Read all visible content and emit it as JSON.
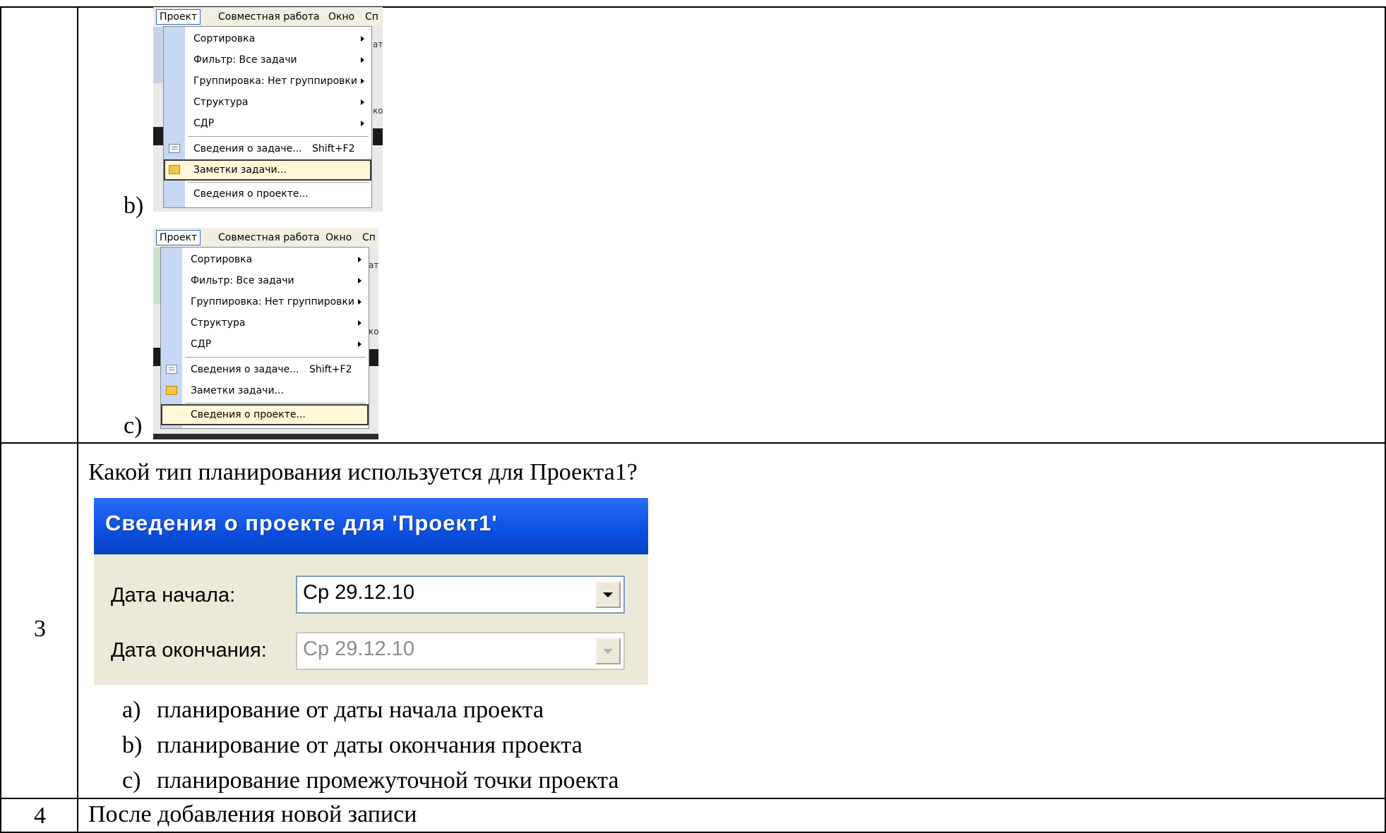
{
  "rows": {
    "row3_number": "3",
    "row4_number": "4"
  },
  "menu_options": [
    {
      "marker": "b)",
      "menubar": [
        "Проект",
        "Совместная работа",
        "Окно",
        "Сп"
      ],
      "background_right_fragments": [
        "ат",
        "ко"
      ],
      "items": [
        {
          "label": "Сортировка",
          "submenu": true
        },
        {
          "label": "Фильтр: Все задачи",
          "submenu": true
        },
        {
          "label": "Группировка: Нет группировки",
          "submenu": true
        },
        {
          "label": "Структура",
          "submenu": true
        },
        {
          "label": "СДР",
          "submenu": true
        },
        {
          "label": "Сведения о задаче...",
          "shortcut": "Shift+F2",
          "icon": "task-info-icon"
        },
        {
          "label": "Заметки задачи...",
          "icon": "task-notes-icon",
          "highlighted": true
        },
        {
          "label": "Сведения о проекте..."
        }
      ]
    },
    {
      "marker": "c)",
      "menubar": [
        "Проект",
        "Совместная работа",
        "Окно",
        "Сп"
      ],
      "background_right_fragments": [
        "ат",
        "ко"
      ],
      "items": [
        {
          "label": "Сортировка",
          "submenu": true
        },
        {
          "label": "Фильтр: Все задачи",
          "submenu": true
        },
        {
          "label": "Группировка: Нет группировки",
          "submenu": true
        },
        {
          "label": "Структура",
          "submenu": true
        },
        {
          "label": "СДР",
          "submenu": true
        },
        {
          "label": "Сведения о задаче...",
          "shortcut": "Shift+F2",
          "icon": "task-info-icon"
        },
        {
          "label": "Заметки задачи...",
          "icon": "task-notes-icon"
        },
        {
          "label": "Сведения о проекте...",
          "highlighted": true
        }
      ]
    }
  ],
  "question3": {
    "text": "Какой тип планирования используется для Проекта1?",
    "dialog": {
      "title": "Сведения о проекте для 'Проект1'",
      "start_label": "Дата начала:",
      "start_value": "Ср 29.12.10",
      "finish_label": "Дата окончания:",
      "finish_value": "Ср 29.12.10"
    },
    "answers": [
      {
        "marker": "a)",
        "text": "планирование от даты начала проекта"
      },
      {
        "marker": "b)",
        "text": "планирование от даты окончания проекта"
      },
      {
        "marker": "c)",
        "text": "планирование промежуточной точки проекта"
      }
    ]
  },
  "question4": {
    "text": "После добавления новой записи"
  },
  "colors": {
    "dialog_title": "#0b4fe0",
    "dialog_body": "#ece9d8",
    "menu_gutter": "#c7d8f5",
    "menu_highlight": "#fff7d6"
  }
}
